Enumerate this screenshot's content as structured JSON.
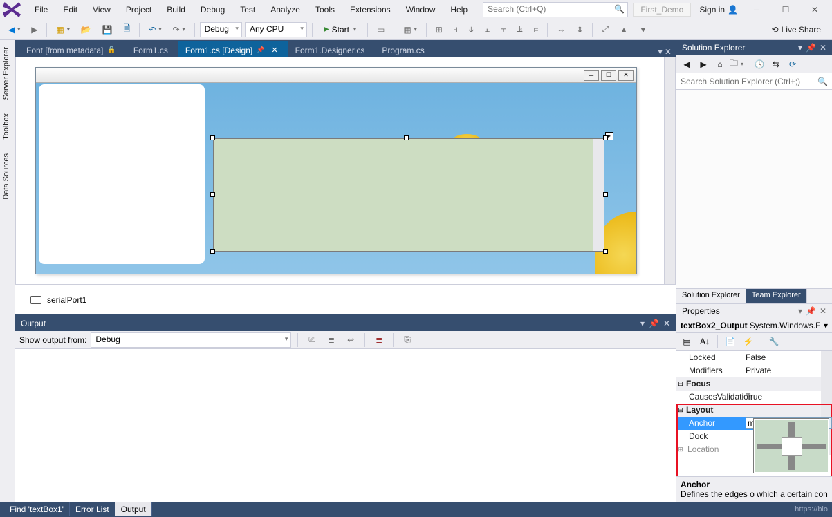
{
  "menu": [
    "File",
    "Edit",
    "View",
    "Project",
    "Build",
    "Debug",
    "Test",
    "Analyze",
    "Tools",
    "Extensions",
    "Window",
    "Help"
  ],
  "quick_search_placeholder": "Search (Ctrl+Q)",
  "solution_name": "First_Demo",
  "signin": "Sign in",
  "liveshare": "Live Share",
  "toolbar": {
    "config": "Debug",
    "platform": "Any CPU",
    "start": "Start"
  },
  "doc_tabs": [
    {
      "label": "Font [from metadata]",
      "state": "locked"
    },
    {
      "label": "Form1.cs",
      "state": "inactive"
    },
    {
      "label": "Form1.cs [Design]",
      "state": "active"
    },
    {
      "label": "Form1.Designer.cs",
      "state": "inactive"
    },
    {
      "label": "Program.cs",
      "state": "inactive"
    }
  ],
  "side_tabs": [
    "Server Explorer",
    "Toolbox",
    "Data Sources"
  ],
  "tray_item": "serialPort1",
  "output": {
    "title": "Output",
    "show_from_label": "Show output from:",
    "show_from_value": "Debug"
  },
  "status_tabs": [
    {
      "label": "Find 'textBox1'",
      "active": false
    },
    {
      "label": "Error List",
      "active": false
    },
    {
      "label": "Output",
      "active": true
    }
  ],
  "watermark": "https://blo",
  "solution_explorer": {
    "title": "Solution Explorer",
    "search_placeholder": "Search Solution Explorer (Ctrl+;)",
    "bottom_tabs": [
      {
        "label": "Solution Explorer",
        "active": false
      },
      {
        "label": "Team Explorer",
        "active": true
      }
    ]
  },
  "properties": {
    "title": "Properties",
    "object_name": "textBox2_Output",
    "object_type": "System.Windows.F",
    "rows": [
      {
        "k": "Locked",
        "v": "False"
      },
      {
        "k": "Modifiers",
        "v": "Private"
      }
    ],
    "cat_focus": "Focus",
    "focus_row": {
      "k": "CausesValidation",
      "v": "True"
    },
    "cat_layout": "Layout",
    "layout_rows": [
      {
        "k": "Anchor",
        "v": "m, Left, Right",
        "sel": true
      },
      {
        "k": "Dock",
        "v": ""
      },
      {
        "k": "Location",
        "v": ""
      }
    ],
    "help_title": "Anchor",
    "help_text": "Defines the edges o which a certain con"
  }
}
